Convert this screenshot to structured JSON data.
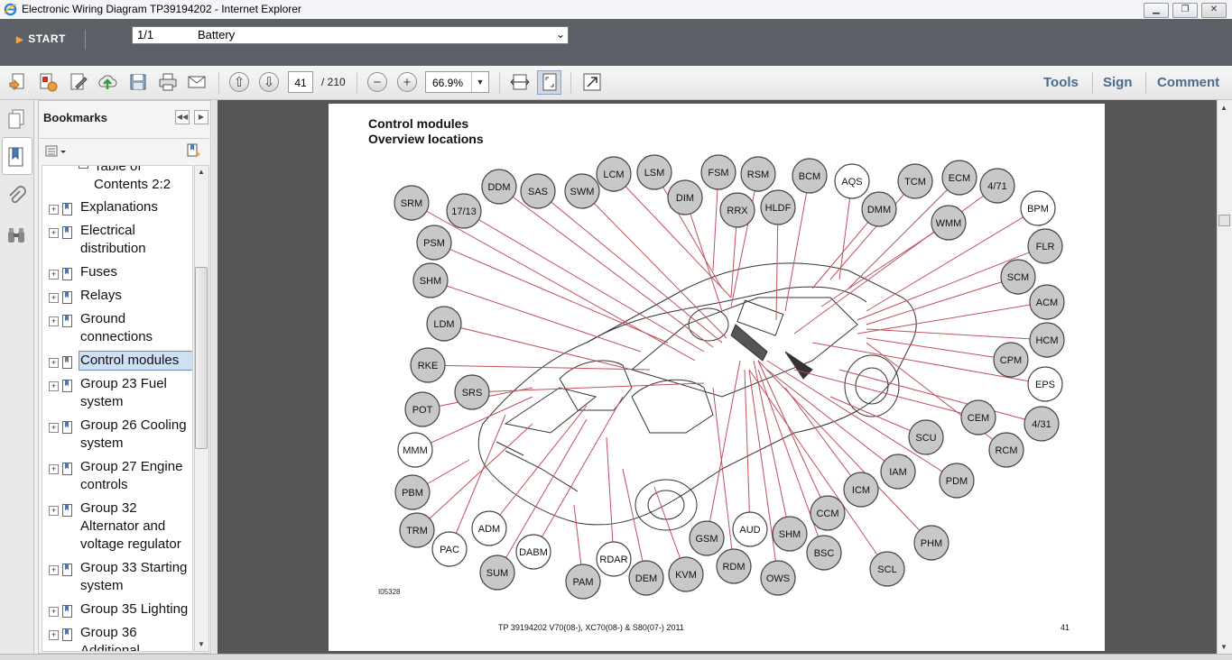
{
  "window": {
    "title": "Electronic Wiring Diagram TP39194202 - Internet Explorer",
    "controls": [
      "minimize",
      "restore",
      "close"
    ]
  },
  "nav": {
    "start_label": "START",
    "select_page": "1/1",
    "select_name": "Battery"
  },
  "toolbar": {
    "page_current": "41",
    "page_total": "/ 210",
    "zoom": "66.9%",
    "tools_label": "Tools",
    "sign_label": "Sign",
    "comment_label": "Comment",
    "icons": [
      "create-icon",
      "convert-icon",
      "edit-icon",
      "upload-icon",
      "save-icon",
      "print-icon",
      "email-icon",
      "page-up-icon",
      "page-down-icon",
      "zoom-out-icon",
      "zoom-in-icon",
      "fit-width-icon",
      "fit-page-icon",
      "full-screen-icon"
    ]
  },
  "bookmarks": {
    "title": "Bookmarks",
    "items": [
      {
        "label": "Table of\nContents 2:2",
        "expandable": false
      },
      {
        "label": "Explanations",
        "expandable": true
      },
      {
        "label": "Electrical distribution",
        "expandable": true
      },
      {
        "label": "Fuses",
        "expandable": true
      },
      {
        "label": "Relays",
        "expandable": true
      },
      {
        "label": "Ground connections",
        "expandable": true
      },
      {
        "label": "Control modules",
        "expandable": true,
        "selected": true
      },
      {
        "label": "Group 23 Fuel system",
        "expandable": true
      },
      {
        "label": "Group 26 Cooling system",
        "expandable": true
      },
      {
        "label": "Group 27 Engine controls",
        "expandable": true
      },
      {
        "label": "Group 32 Alternator and voltage regulator",
        "expandable": true
      },
      {
        "label": "Group 33 Starting system",
        "expandable": true
      },
      {
        "label": "Group 35 Lighting",
        "expandable": true
      },
      {
        "label": "Group 36 Additional",
        "expandable": true
      }
    ]
  },
  "document": {
    "title_line1": "Control modules",
    "title_line2": "Overview locations",
    "figure_id": "I05328",
    "footer": "TP 39194202 V70(08-), XC70(08-) & S80(07-) 2011",
    "page_number": "41",
    "modules_grey": [
      "SRM",
      "17/13",
      "DDM",
      "SAS",
      "SWM",
      "LCM",
      "LSM",
      "DIM",
      "FSM",
      "RSM",
      "RRX",
      "HLDF",
      "BCM",
      "DMM",
      "TCM",
      "ECM",
      "4/71",
      "WMM",
      "FLR",
      "SCM",
      "ACM",
      "HCM",
      "CPM",
      "CEM",
      "4/31",
      "RCM",
      "PDM",
      "SCU",
      "IAM",
      "ICM",
      "PHM",
      "SCL",
      "CCM",
      "BSC",
      "SHM",
      "OWS",
      "RDM",
      "KVM",
      "GSM",
      "DEM",
      "PAM",
      "SUM",
      "TRM",
      "PBM",
      "POT",
      "RKE",
      "SRS",
      "LDM",
      "SHM",
      "PSM"
    ],
    "modules_white": [
      "AQS",
      "BPM",
      "EPS",
      "AUD",
      "RDAR",
      "DABM",
      "ADM",
      "PAC",
      "MMM"
    ],
    "line_color": "#c0505a",
    "grey_fill": "#c8c8c8"
  }
}
